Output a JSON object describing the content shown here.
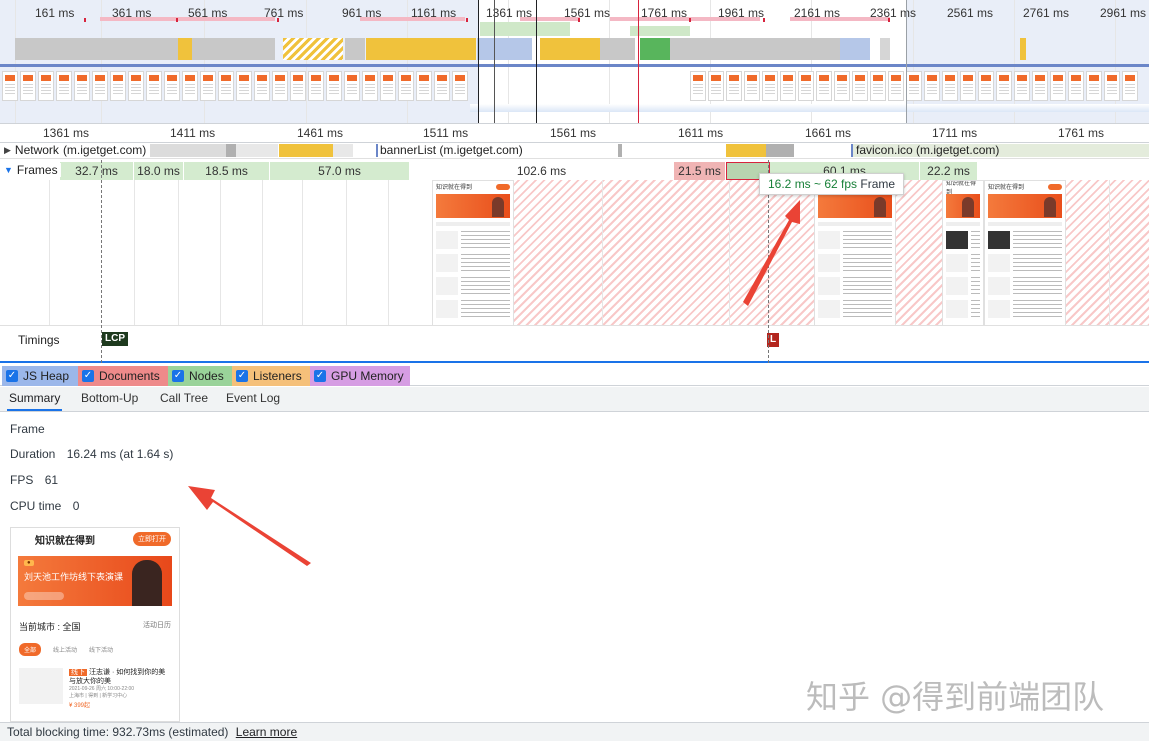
{
  "overview": {
    "tick_labels": [
      "161 ms",
      "361 ms",
      "561 ms",
      "761 ms",
      "961 ms",
      "1161 ms",
      "1361 ms",
      "1561 ms",
      "1761 ms",
      "1961 ms",
      "2161 ms",
      "2361 ms",
      "2561 ms",
      "2761 ms",
      "2961 ms"
    ]
  },
  "ruler": {
    "labels": [
      "1361 ms",
      "1411 ms",
      "1461 ms",
      "1511 ms",
      "1561 ms",
      "1611 ms",
      "1661 ms",
      "1711 ms",
      "1761 ms"
    ]
  },
  "network": {
    "title": "Network",
    "first_request": "(m.igetget.com)",
    "request_2": "bannerList (m.igetget.com)",
    "request_3": "favicon.ico (m.igetget.com)"
  },
  "frames": {
    "title": "Frames",
    "durations": [
      "32.7 ms",
      "18.0 ms",
      "18.5 ms",
      "57.0 ms",
      "102.6 ms",
      "21.5 ms",
      "60.1 ms",
      "22.2 ms"
    ],
    "thumb_header": "知识就在得到"
  },
  "tooltip": {
    "fps_text": "16.2 ms ~ 62 fps",
    "kind": "Frame"
  },
  "timings": {
    "title": "Timings",
    "lcp_label": "LCP",
    "load_label": "L",
    "lcp_color": "#1e3a1e",
    "load_color": "#b3261e"
  },
  "memory": {
    "items": [
      {
        "label": "JS Heap",
        "color": "#9bb7ea"
      },
      {
        "label": "Documents",
        "color": "#ee8a8a"
      },
      {
        "label": "Nodes",
        "color": "#9ad39a"
      },
      {
        "label": "Listeners",
        "color": "#f5c07a"
      },
      {
        "label": "GPU Memory",
        "color": "#d69de3"
      }
    ]
  },
  "tabs": [
    "Summary",
    "Bottom-Up",
    "Call Tree",
    "Event Log"
  ],
  "summary": {
    "heading": "Frame",
    "duration_label": "Duration",
    "duration_value": "16.24 ms (at 1.64 s)",
    "fps_label": "FPS",
    "fps_value": "61",
    "cpu_label": "CPU time",
    "cpu_value": "0"
  },
  "screenshot": {
    "header": "知识就在得到",
    "open_button": "立即打开",
    "banner_title": "刘天池工作坊线下表演课",
    "city_label": "当前城市 : 全国",
    "city_right": "活动日历",
    "filters": [
      "全部",
      "线上活动",
      "线下活动"
    ],
    "item_tag": "线下",
    "item_title": "汪志谦 · 如何找到你的美与放大你的美",
    "item_meta": "2021-09-26 周六 10:00-22:00",
    "item_place": "上海市 | 得到 | 新学习中心",
    "item_price": "¥ 399起"
  },
  "watermark": "知乎 @得到前端团队",
  "footer": {
    "blocking_text": "Total blocking time: 932.73ms (estimated)",
    "learn_more": "Learn more"
  }
}
